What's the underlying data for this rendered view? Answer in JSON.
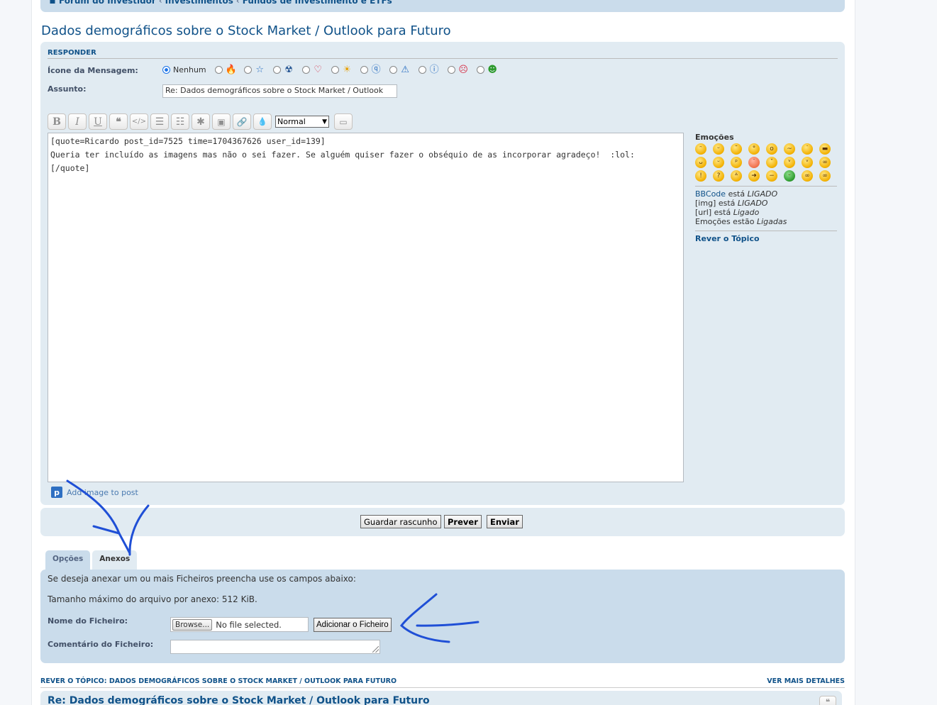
{
  "breadcrumbs": [
    "Fórum do Investidor",
    "Investimentos",
    "Fundos de Investimento e ETFs"
  ],
  "page_title": "Dados demográficos sobre o Stock Market / Outlook para Futuro",
  "form": {
    "heading": "RESPONDER",
    "message_icon_label": "Ícone da Mensagem:",
    "icon_none_label": "Nenhum",
    "icons": [
      "fire-icon",
      "star-icon",
      "radiation-icon",
      "heart-icon",
      "sun-icon",
      "question-icon",
      "warning-icon",
      "info-icon",
      "mad-icon",
      "sick-icon"
    ],
    "subject_label": "Assunto:",
    "subject_value": "Re: Dados demográficos sobre o Stock Market / Outlook",
    "font_size_value": "Normal",
    "editor_text": "[quote=Ricardo post_id=7525 time=1704367626 user_id=139]\nQueria ter incluído as imagens mas não o sei fazer. Se alguém quiser fazer o obséquio de as incorporar agradeço!  :lol:\n[/quote]",
    "add_image_link": "Add image to post"
  },
  "sidebar": {
    "smilies_heading": "Emoções",
    "bbcode_link": "BBCode",
    "status_word_is": "está",
    "status_word_are": "estão",
    "bbcode_state": "LIGADO",
    "img_label": "[img]",
    "img_state": "LIGADO",
    "url_label": "[url]",
    "url_state": "Ligado",
    "smilies_label": "Emoções",
    "smilies_state": "Ligadas",
    "review_topic": "Rever o Tópico"
  },
  "buttons": {
    "save_draft": "Guardar rascunho",
    "preview": "Prever",
    "submit": "Enviar"
  },
  "tabs": {
    "options": "Opções",
    "attachments": "Anexos"
  },
  "attachments": {
    "intro": "Se deseja anexar um ou mais Ficheiros preencha use os campos abaixo:",
    "max_size": "Tamanho máximo do arquivo por anexo: 512 KiB.",
    "filename_label": "Nome do Ficheiro:",
    "browse_label": "Browse...",
    "no_file": "No file selected.",
    "add_file_button": "Adicionar o Ficheiro",
    "comment_label": "Comentário do Ficheiro:"
  },
  "review": {
    "left": "REVER O TÓPICO: DADOS DEMOGRÁFICOS SOBRE O STOCK MARKET / OUTLOOK PARA FUTURO",
    "right": "VER MAIS DETALHES",
    "post_title": "Re: Dados demográficos sobre o Stock Market / Outlook para Futuro"
  },
  "colors": {
    "link": "#105289",
    "panel_bg": "#e1ebf2",
    "attach_bg": "#cadceb",
    "annotation": "#1f4fd6"
  }
}
